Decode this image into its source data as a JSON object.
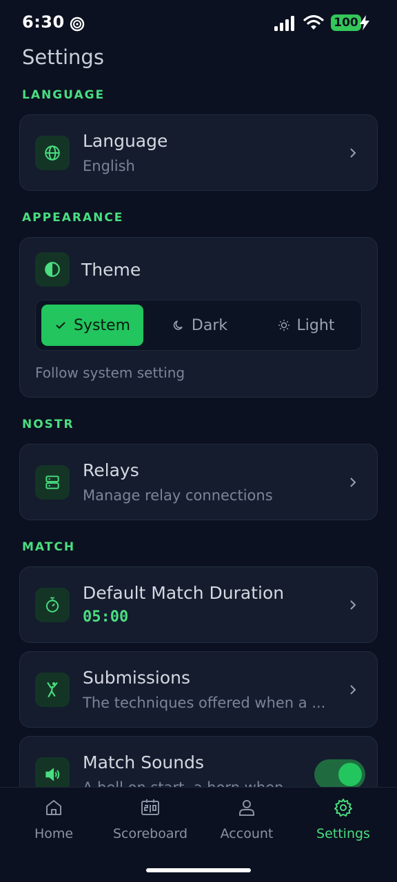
{
  "status_bar": {
    "time": "6:30",
    "battery": "100",
    "icons": [
      "focus-icon",
      "signal-icon",
      "wifi-icon",
      "battery-icon",
      "charging-bolt-icon"
    ]
  },
  "header": {
    "title": "Settings"
  },
  "sections": {
    "language": {
      "label": "LANGUAGE",
      "item": {
        "icon": "globe-icon",
        "title": "Language",
        "value": "English"
      }
    },
    "appearance": {
      "label": "APPEARANCE",
      "theme": {
        "icon": "contrast-icon",
        "title": "Theme",
        "options": [
          {
            "label": "System",
            "icon": "check-icon",
            "selected": true
          },
          {
            "label": "Dark",
            "icon": "moon-icon",
            "selected": false
          },
          {
            "label": "Light",
            "icon": "sun-icon",
            "selected": false
          }
        ],
        "description": "Follow system setting"
      }
    },
    "nostr": {
      "label": "NOSTR",
      "item": {
        "icon": "server-icon",
        "title": "Relays",
        "subtitle": "Manage relay connections"
      }
    },
    "match": {
      "label": "MATCH",
      "duration": {
        "icon": "stopwatch-icon",
        "title": "Default Match Duration",
        "value": "05:00"
      },
      "submissions": {
        "icon": "martial-arts-icon",
        "title": "Submissions",
        "subtitle": "The techniques offered when a ..."
      },
      "sounds": {
        "icon": "speaker-icon",
        "title": "Match Sounds",
        "subtitle": "A bell on start, a horn when",
        "enabled": true
      }
    }
  },
  "bottom_nav": {
    "items": [
      {
        "label": "Home",
        "icon": "home-icon",
        "active": false
      },
      {
        "label": "Scoreboard",
        "icon": "scoreboard-icon",
        "active": false
      },
      {
        "label": "Account",
        "icon": "user-icon",
        "active": false
      },
      {
        "label": "Settings",
        "icon": "gear-icon",
        "active": true
      }
    ]
  },
  "colors": {
    "background": "#0b1120",
    "card": "#141c2e",
    "accent": "#4ade80",
    "accent_fill": "#22c55e",
    "icon_tile": "#143526"
  }
}
